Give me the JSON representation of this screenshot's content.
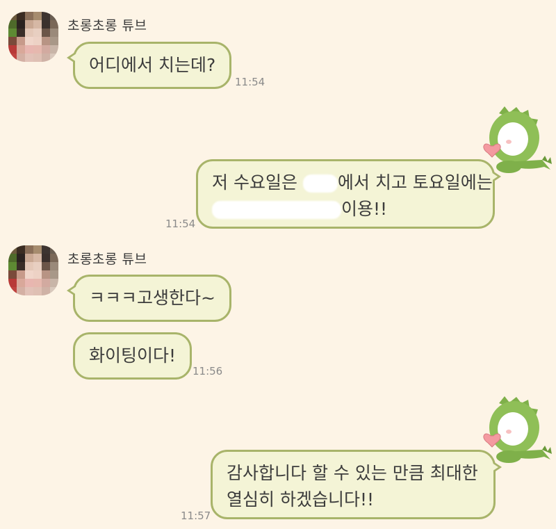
{
  "colors": {
    "background": "#fdf4e6",
    "bubble_fill": "#f4f4d6",
    "bubble_border": "#a8b46a",
    "timestamp": "#8a8a8a"
  },
  "messages": [
    {
      "sender": "초롱초롱 튜브",
      "text": "어디에서 치는데?",
      "time": "11:54"
    },
    {
      "line1_before": "저 수요일은",
      "line1_after": "에서 치고 토요일에는",
      "line2_after": "이용!!",
      "time": "11:54"
    },
    {
      "sender": "초롱초롱 튜브",
      "text": "ㅋㅋㅋ고생한다~"
    },
    {
      "text": "화이팅이다!",
      "time": "11:56"
    },
    {
      "line1": "감사합니다 할 수 있는 만큼 최대한",
      "line2": "열심히 하겠습니다!!",
      "time": "11:57"
    }
  ],
  "icons": {
    "avatar": "pixelated-avatar-icon",
    "sticker": "dinosaur-costume-heart-sticker-icon"
  }
}
